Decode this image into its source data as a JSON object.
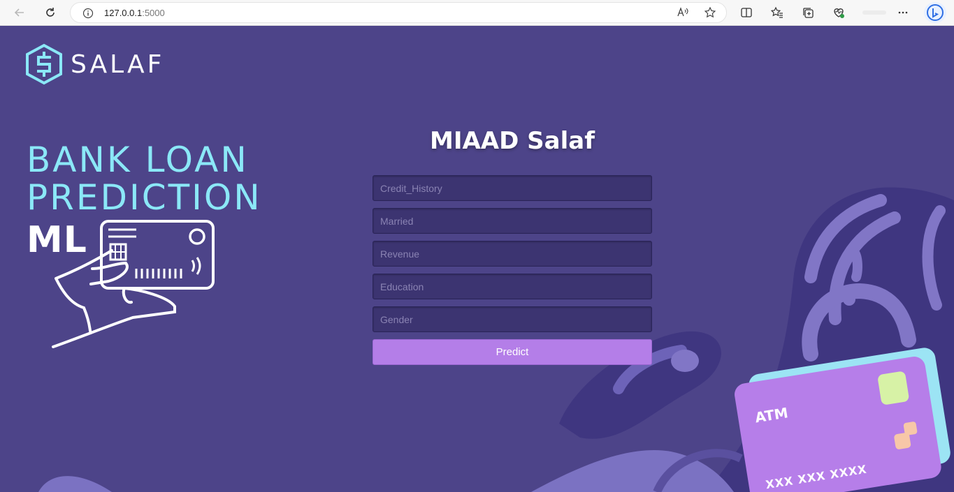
{
  "browser": {
    "url_host": "127.0.0.1",
    "url_port": ":5000"
  },
  "brand": {
    "name": "SALAF"
  },
  "hero": {
    "line1": "BANK LOAN",
    "line2": "PREDICTION",
    "line3": "ML"
  },
  "form": {
    "title": "MIAAD Salaf",
    "fields": [
      {
        "placeholder": "Credit_History"
      },
      {
        "placeholder": "Married"
      },
      {
        "placeholder": "Revenue"
      },
      {
        "placeholder": "Education"
      },
      {
        "placeholder": "Gender"
      }
    ],
    "submit_label": "Predict"
  },
  "atm_card": {
    "label": "ATM",
    "number": "XXX XXX XXXX"
  },
  "colors": {
    "background": "#4d4489",
    "accent_cyan": "#8be8f7",
    "button": "#b47ee8",
    "field_bg": "#3c3471"
  }
}
